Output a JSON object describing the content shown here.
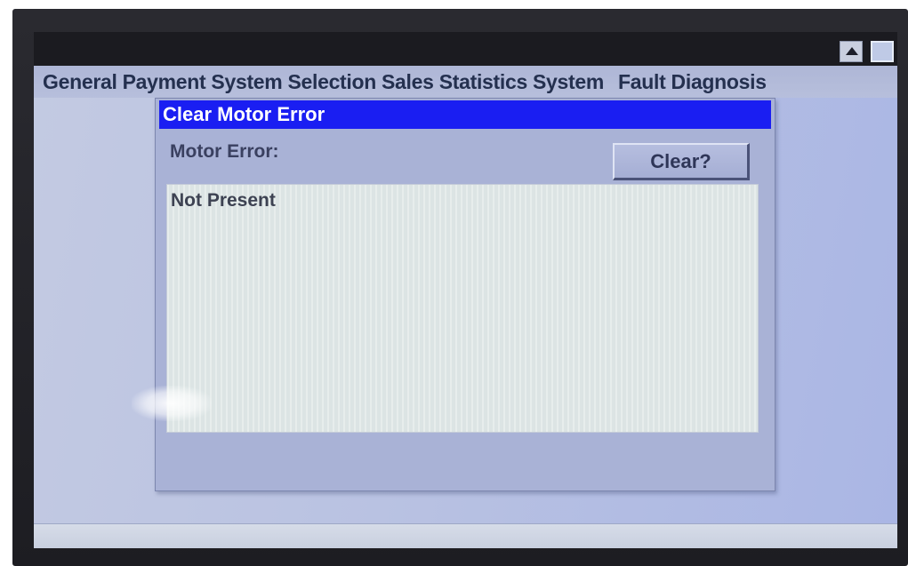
{
  "menu": [
    {
      "label": "General"
    },
    {
      "label": "Payment System"
    },
    {
      "label": "Selection"
    },
    {
      "label": "Sales Statistics"
    },
    {
      "label": "System"
    },
    {
      "label": "Fault Diagnosis"
    }
  ],
  "dialog": {
    "title": "Clear Motor Error",
    "field_label": "Motor Error:",
    "clear_button_label": "Clear?",
    "output_text": "Not Present",
    "title_bar_color": "#1a1ef2"
  },
  "window_controls": {
    "scroll_up_icon": "triangle-up-icon",
    "square_icon": "square-icon"
  }
}
